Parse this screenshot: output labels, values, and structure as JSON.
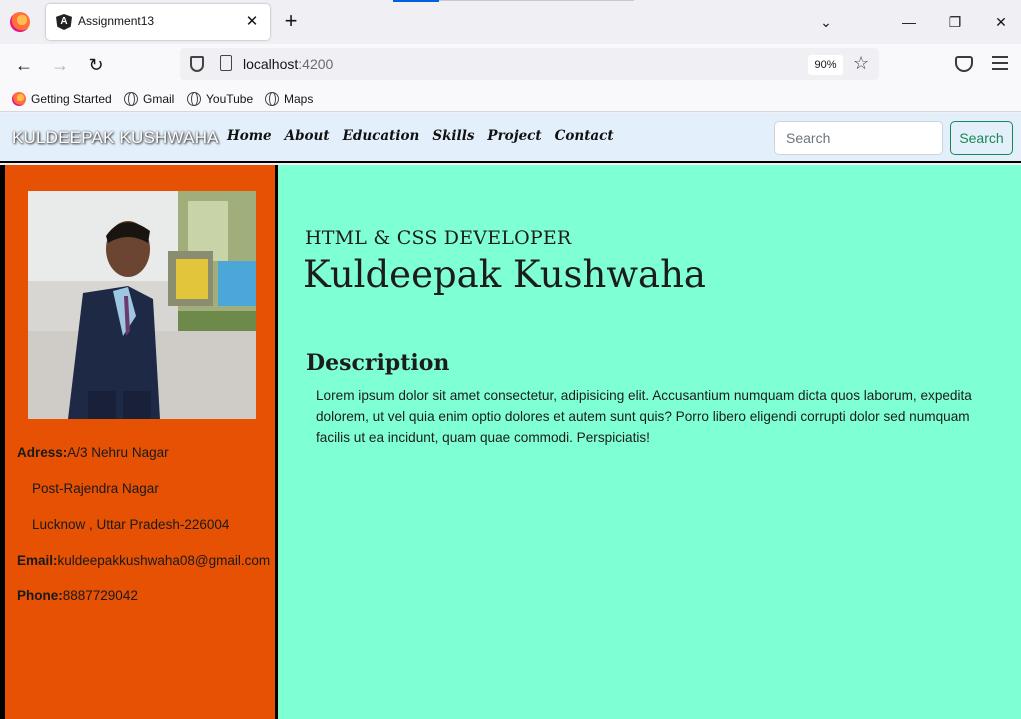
{
  "browser": {
    "tab_title": "Assignment13",
    "tab_close": "✕",
    "new_tab": "+",
    "tablist": "⌄",
    "win_min": "—",
    "win_restore": "❐",
    "win_close": "✕",
    "back": "←",
    "forward": "→",
    "reload": "↻",
    "url_host": "localhost",
    "url_port": ":4200",
    "zoom": "90%",
    "star": "☆",
    "bookmarks": [
      "Getting Started",
      "Gmail",
      "YouTube",
      "Maps"
    ]
  },
  "site_nav": {
    "brand": "KULDEEPAK KUSHWAHA",
    "links": [
      "Home",
      "About",
      "Education",
      "Skills",
      "Project",
      "Contact"
    ],
    "search_placeholder": "Search",
    "search_button": "Search"
  },
  "sidebar": {
    "address_label": "Adress:",
    "address_line1": "A/3 Nehru Nagar",
    "address_line2": "Post-Rajendra Nagar",
    "address_line3": "Lucknow , Uttar Pradesh-226004",
    "email_label": "Email:",
    "email": "kuldeepakkushwaha08@gmail.com",
    "phone_label": "Phone:",
    "phone": "8887729042"
  },
  "main": {
    "role": "HTML & CSS DEVELOPER",
    "name": "Kuldeepak Kushwaha",
    "description_title": "Description",
    "description_text": "Lorem ipsum dolor sit amet consectetur, adipisicing elit. Accusantium numquam dicta quos laborum, expedita dolorem, ut vel quia enim optio dolores et autem sunt quis? Porro libero eligendi corrupti dolor sed numquam facilis ut ea incidunt, quam quae commodi. Perspiciatis!"
  }
}
